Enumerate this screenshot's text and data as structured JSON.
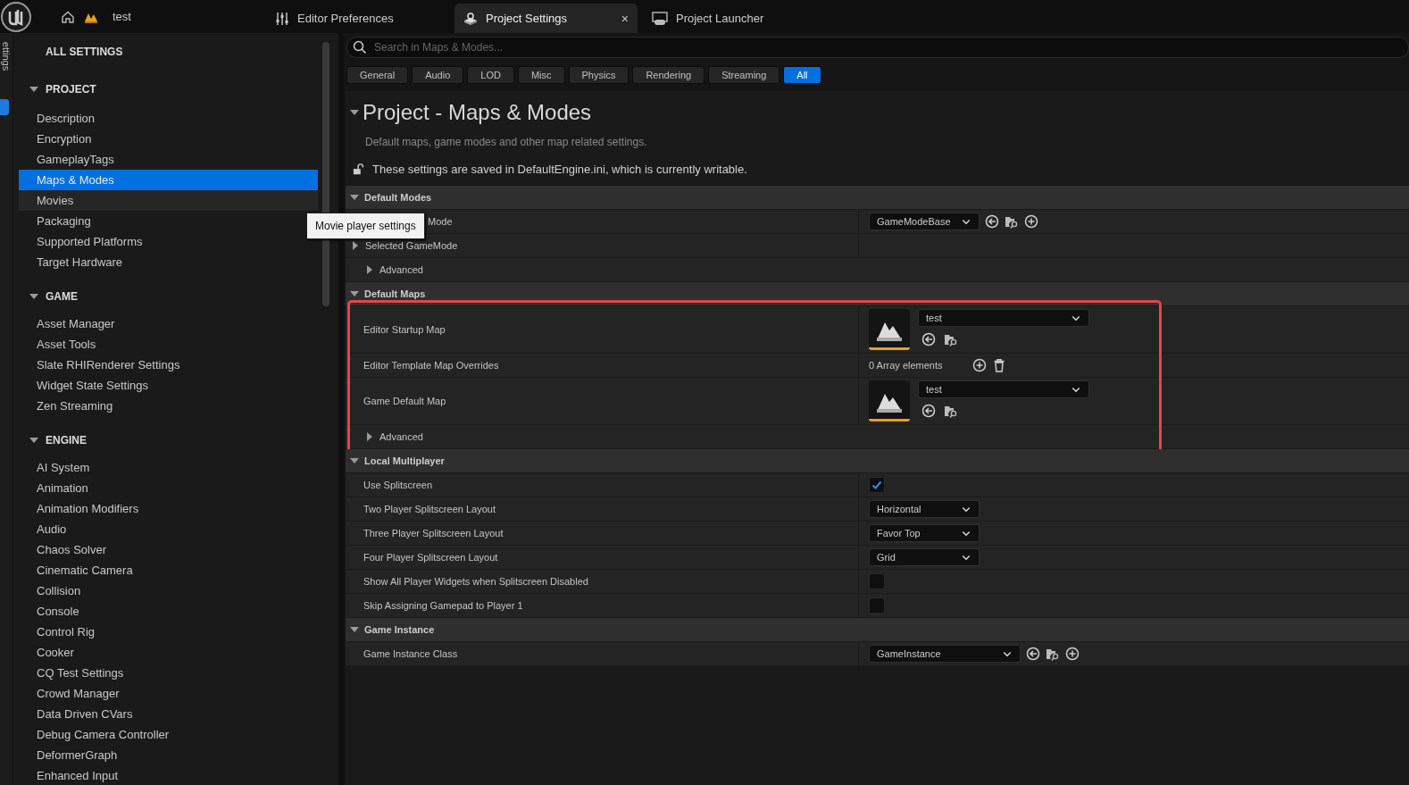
{
  "top_bar": {
    "project": "test",
    "tabs": [
      {
        "label": "Editor Preferences",
        "selected": false,
        "closable": false
      },
      {
        "label": "Project Settings",
        "selected": true,
        "closable": true
      },
      {
        "label": "Project Launcher",
        "selected": false,
        "closable": false
      }
    ],
    "close": "×"
  },
  "side_strip": {
    "label": "ettings"
  },
  "sidebar": {
    "title": "ALL SETTINGS",
    "sections": [
      {
        "label": "PROJECT",
        "expanded": true,
        "items": [
          {
            "label": "Description",
            "selected": false,
            "hovered": false
          },
          {
            "label": "Encryption",
            "selected": false,
            "hovered": false
          },
          {
            "label": "GameplayTags",
            "selected": false,
            "hovered": false
          },
          {
            "label": "Maps & Modes",
            "selected": true,
            "hovered": false
          },
          {
            "label": "Movies",
            "selected": false,
            "hovered": true
          },
          {
            "label": "Packaging",
            "selected": false,
            "hovered": false
          },
          {
            "label": "Supported Platforms",
            "selected": false,
            "hovered": false
          },
          {
            "label": "Target Hardware",
            "selected": false,
            "hovered": false
          }
        ]
      },
      {
        "label": "GAME",
        "expanded": true,
        "items": [
          {
            "label": "Asset Manager",
            "selected": false,
            "hovered": false
          },
          {
            "label": "Asset Tools",
            "selected": false,
            "hovered": false
          },
          {
            "label": "Slate RHIRenderer Settings",
            "selected": false,
            "hovered": false
          },
          {
            "label": "Widget State Settings",
            "selected": false,
            "hovered": false
          },
          {
            "label": "Zen Streaming",
            "selected": false,
            "hovered": false
          }
        ]
      },
      {
        "label": "ENGINE",
        "expanded": true,
        "items": [
          {
            "label": "AI System",
            "selected": false,
            "hovered": false
          },
          {
            "label": "Animation",
            "selected": false,
            "hovered": false
          },
          {
            "label": "Animation Modifiers",
            "selected": false,
            "hovered": false
          },
          {
            "label": "Audio",
            "selected": false,
            "hovered": false
          },
          {
            "label": "Chaos Solver",
            "selected": false,
            "hovered": false
          },
          {
            "label": "Cinematic Camera",
            "selected": false,
            "hovered": false
          },
          {
            "label": "Collision",
            "selected": false,
            "hovered": false
          },
          {
            "label": "Console",
            "selected": false,
            "hovered": false
          },
          {
            "label": "Control Rig",
            "selected": false,
            "hovered": false
          },
          {
            "label": "Cooker",
            "selected": false,
            "hovered": false
          },
          {
            "label": "CQ Test Settings",
            "selected": false,
            "hovered": false
          },
          {
            "label": "Crowd Manager",
            "selected": false,
            "hovered": false
          },
          {
            "label": "Data Driven CVars",
            "selected": false,
            "hovered": false
          },
          {
            "label": "Debug Camera Controller",
            "selected": false,
            "hovered": false
          },
          {
            "label": "DeformerGraph",
            "selected": false,
            "hovered": false
          },
          {
            "label": "Enhanced Input",
            "selected": false,
            "hovered": false
          }
        ]
      }
    ]
  },
  "tooltip": "Movie player settings",
  "search": {
    "placeholder": "Search in Maps & Modes..."
  },
  "filters": [
    {
      "label": "General",
      "selected": false
    },
    {
      "label": "Audio",
      "selected": false
    },
    {
      "label": "LOD",
      "selected": false
    },
    {
      "label": "Misc",
      "selected": false
    },
    {
      "label": "Physics",
      "selected": false
    },
    {
      "label": "Rendering",
      "selected": false
    },
    {
      "label": "Streaming",
      "selected": false
    },
    {
      "label": "All",
      "selected": true
    }
  ],
  "page": {
    "title": "Project - Maps & Modes",
    "description": "Default maps, game modes and other map related settings.",
    "note": "These settings are saved in DefaultEngine.ini, which is currently writable."
  },
  "categories": [
    {
      "label": "Default Modes",
      "expanded": true,
      "highlighted": false,
      "rows": [
        {
          "kind": "class",
          "label": "Mode",
          "partly_hidden": true,
          "value": "GameModeBase"
        },
        {
          "kind": "group",
          "label": "Selected GameMode",
          "expanded": false
        },
        {
          "kind": "advanced",
          "label": "Advanced",
          "expanded": false
        }
      ]
    },
    {
      "label": "Default Maps",
      "expanded": true,
      "highlighted": true,
      "rows": [
        {
          "kind": "asset",
          "label": "Editor Startup Map",
          "value": "test"
        },
        {
          "kind": "array",
          "label": "Editor Template Map Overrides",
          "value": "0 Array elements"
        },
        {
          "kind": "asset",
          "label": "Game Default Map",
          "value": "test"
        },
        {
          "kind": "advanced",
          "label": "Advanced",
          "expanded": false
        }
      ]
    },
    {
      "label": "Local Multiplayer",
      "expanded": true,
      "highlighted": false,
      "rows": [
        {
          "kind": "checkbox",
          "label": "Use Splitscreen",
          "checked": true
        },
        {
          "kind": "combo",
          "label": "Two Player Splitscreen Layout",
          "value": "Horizontal"
        },
        {
          "kind": "combo",
          "label": "Three Player Splitscreen Layout",
          "value": "Favor Top"
        },
        {
          "kind": "combo",
          "label": "Four Player Splitscreen Layout",
          "value": "Grid"
        },
        {
          "kind": "checkbox",
          "label": "Show All Player Widgets when Splitscreen Disabled",
          "checked": false
        },
        {
          "kind": "checkbox",
          "label": "Skip Assigning Gamepad to Player 1",
          "checked": false
        }
      ]
    },
    {
      "label": "Game Instance",
      "expanded": true,
      "highlighted": false,
      "rows": [
        {
          "kind": "class",
          "label": "Game Instance Class",
          "partly_hidden": false,
          "value": "GameInstance",
          "wide": true
        }
      ]
    }
  ]
}
